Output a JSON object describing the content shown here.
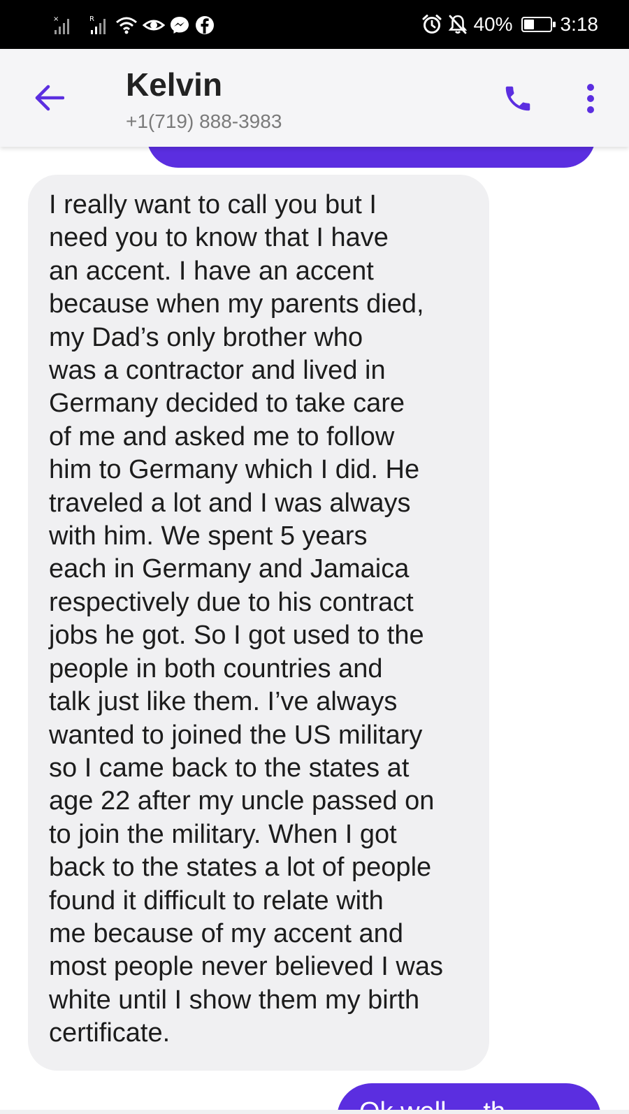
{
  "status_bar": {
    "battery_text": "40%",
    "battery_level": 0.4,
    "time": "3:18",
    "icons": [
      "no-sim-signal-icon",
      "roaming-signal-icon",
      "wifi-icon",
      "eye-comfort-icon",
      "messenger-icon",
      "facebook-icon",
      "alarm-icon",
      "notifications-muted-icon",
      "battery-icon"
    ]
  },
  "header": {
    "contact_name": "Kelvin",
    "contact_number": "+1(719) 888-3983",
    "icons": [
      "back-arrow-icon",
      "phone-icon",
      "more-vert-icon"
    ]
  },
  "conversation": {
    "received_message": "I really want to call you but I\nneed you to know that I have\nan accent. I have an accent\nbecause when my parents died,\nmy Dad’s only brother who\nwas a contractor and lived in\nGermany decided to take care\nof me and asked me to follow\nhim to Germany which I did. He\ntraveled a lot and I was always\nwith him. We spent 5 years\neach in Germany and Jamaica\nrespectively due to his contract\njobs he got. So I got used to the\npeople in both countries and\ntalk just like them. I’ve always\nwanted to joined the US military\nso I came back to the states at\nage 22 after my uncle passed on\nto join the military. When I got\nback to the states a lot of people\nfound it difficult to relate with\nme because of my accent and\nmost people never believed I was\nwhite until I show them my birth\ncertificate.",
    "sent_message_partial": "Ok well ... th"
  },
  "colors": {
    "accent": "#5b2ee0",
    "received_bubble": "#f0f0f2",
    "header_bg": "#f5f5f7",
    "status_bar_bg": "#000000"
  }
}
